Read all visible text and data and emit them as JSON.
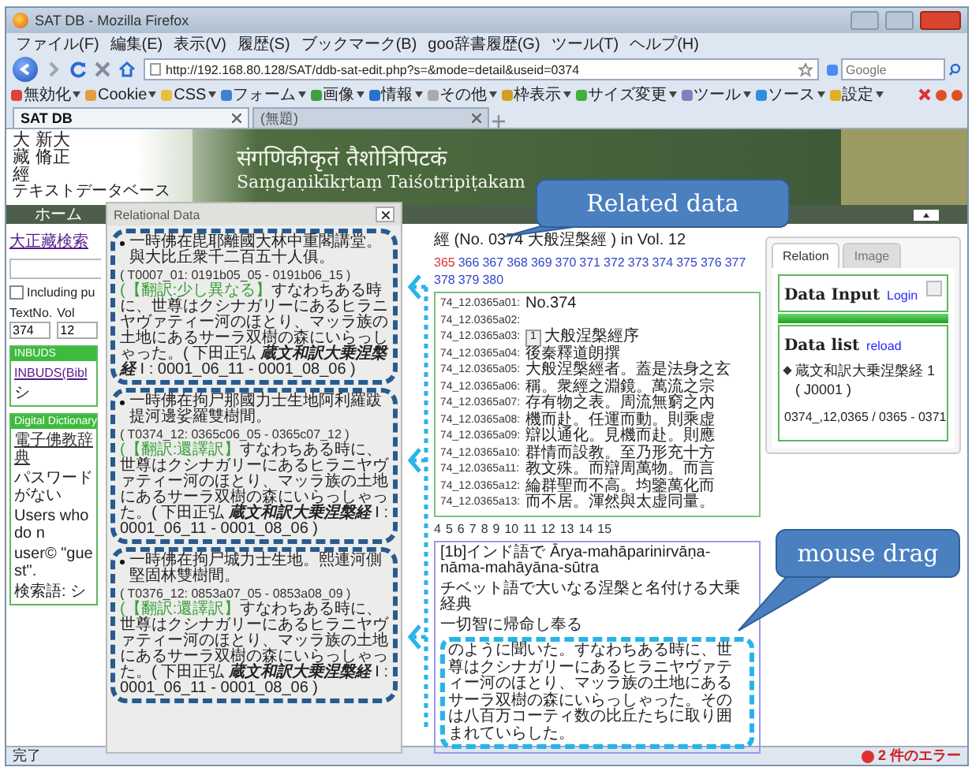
{
  "window": {
    "title": "SAT DB - Mozilla Firefox"
  },
  "menu": [
    "ファイル(F)",
    "編集(E)",
    "表示(V)",
    "履歴(S)",
    "ブックマーク(B)",
    "goo辞書履歴(G)",
    "ツール(T)",
    "ヘルプ(H)"
  ],
  "address_bar": {
    "value": "http://192.168.80.128/SAT/ddb-sat-edit.php?s=&mode=detail&useid=0374"
  },
  "search_bar": {
    "placeholder": "Google"
  },
  "toolbar": [
    "無効化",
    "Cookie",
    "CSS",
    "フォーム",
    "画像",
    "情報",
    "その他",
    "枠表示",
    "サイズ変更",
    "ツール",
    "ソース",
    "設定"
  ],
  "tabs": [
    {
      "label": "SAT DB",
      "selected": true
    },
    {
      "label": "(無題)",
      "selected": false
    }
  ],
  "header": {
    "logo_lines": [
      "大 新大",
      "藏 脩正",
      "經"
    ],
    "subtitle": "テキストデータベース",
    "title": "संगणिकीकृतं तैशोत्रिपिटकं",
    "title_latin": "Saṃgaṇikīkṛtaṃ Taiśotripiṭakam"
  },
  "nav": [
    "ホーム"
  ],
  "left": {
    "search_link": "大正藏検索",
    "checkbox": {
      "label": "Including pu",
      "checked": false
    },
    "fields": [
      {
        "label": "TextNo.",
        "value": "374"
      },
      {
        "label": "Vol",
        "value": "12"
      }
    ],
    "inbuds": {
      "title": "INBUDS",
      "link": "INBUDS(Bibl",
      "text": "シ"
    },
    "dictionary": {
      "title": "Digital Dictionary",
      "link": "電子佛教辞典",
      "lines": [
        "パスワードがない",
        "Users who do n",
        "user© \"guest\"."
      ],
      "search": "検索語: シ"
    }
  },
  "relational_panel": {
    "title": "Relational Data",
    "items": [
      {
        "source": "一時佛在毘耶離國大林中重閣講堂。與大比丘衆千二百五十人俱。",
        "ref": "( T0007_01: 0191b05_05 - 0191b06_15 )",
        "label": "(【翻訳:少し異なる】",
        "translation": "すなわちある時に、世尊はクシナガリーにあるヒラニヤヴァティー河のほとり、マッラ族の土地にあるサーラ双樹の森にいらっしゃった。( 下田正弘 **蔵文和訳大乗涅槃経** I : 0001_06_11 - 0001_08_06 )"
      },
      {
        "source": "一時佛在拘尸那國力士生地阿利羅跋提河邊娑羅雙樹間。",
        "ref": "( T0374_12: 0365c06_05 - 0365c07_12 )",
        "label": "(【翻訳:還譯訳】",
        "translation": "すなわちある時に、世尊はクシナガリーにあるヒラニヤヴァティー河のほとり、マッラ族の土地にあるサーラ双樹の森にいらっしゃった。( 下田正弘 **蔵文和訳大乗涅槃経** I : 0001_06_11 - 0001_08_06 )"
      },
      {
        "source": "一時佛在拘尸城力士生地。熙連河側堅固林雙樹間。",
        "ref": "( T0376_12: 0853a07_05 - 0853a08_09 )",
        "label": "(【翻訳:還譯訳】",
        "translation": "すなわちある時に、世尊はクシナガリーにあるヒラニヤヴァティー河のほとり、マッラ族の土地にあるサーラ双樹の森にいらっしゃった。( 下田正弘 **蔵文和訳大乗涅槃経** I : 0001_06_11 - 0001_08_06 )"
      }
    ]
  },
  "text_view": {
    "title": "經 (No. 0374 大般涅槃經 ) in Vol. 12",
    "pages": [
      {
        "label": "365",
        "selected": true
      },
      {
        "label": "366",
        "selected": false
      },
      {
        "label": "367",
        "selected": false
      },
      {
        "label": "368",
        "selected": false
      },
      {
        "label": "369",
        "selected": false
      },
      {
        "label": "370",
        "selected": false
      },
      {
        "label": "371",
        "selected": false
      },
      {
        "label": "372",
        "selected": false
      },
      {
        "label": "373",
        "selected": false
      },
      {
        "label": "374",
        "selected": false
      },
      {
        "label": "375",
        "selected": false
      },
      {
        "label": "376",
        "selected": false
      },
      {
        "label": "377",
        "selected": false
      },
      {
        "label": "378",
        "selected": false
      },
      {
        "label": "379",
        "selected": false
      },
      {
        "label": "380",
        "selected": false
      }
    ],
    "lines": [
      {
        "ref": "74_12.0365a01:",
        "text": "No.374"
      },
      {
        "ref": "74_12.0365a02:"
      },
      {
        "ref": "74_12.0365a03:",
        "marker": "1",
        "text": "大般涅槃經序"
      },
      {
        "ref": "74_12.0365a04:",
        "text": "後秦釋道朗撰"
      },
      {
        "ref": "74_12.0365a05:",
        "text": "大般涅槃經者。蓋是法身之玄"
      },
      {
        "ref": "74_12.0365a06:",
        "text": "稱。衆經之淵鏡。萬流之宗"
      },
      {
        "ref": "74_12.0365a07:",
        "text": "存有物之表。周流無窮之內"
      },
      {
        "ref": "74_12.0365a08:",
        "text": "機而赴。任運而動。則乘虚"
      },
      {
        "ref": "74_12.0365a09:",
        "text": "辯以通化。見機而赴。則應"
      },
      {
        "ref": "74_12.0365a10:",
        "text": "群情而設教。至乃形充十方"
      },
      {
        "ref": "74_12.0365a11:",
        "text": "教文殊。而辯周萬物。而言"
      },
      {
        "ref": "74_12.0365a12:",
        "text": "綸群聖而不高。均鑒萬化而"
      },
      {
        "ref": "74_12.0365a13:",
        "text": "而不居。渾然與太虚同量。"
      }
    ],
    "page_links": [
      "4",
      "5",
      "6",
      "7",
      "8",
      "9",
      "10",
      "11",
      "12",
      "13",
      "14",
      "15"
    ],
    "translation": [
      "[1b]インド語で Ārya-mahāparinirvāṇa-nāma-mahāyāna-sūtra",
      "チベット語で大いなる涅槃と名付ける大乗経典",
      "一切智に帰命し奉る",
      "のように聞いた。すなわちある時に、世尊はクシナガリーにあるヒラニヤヴァティー河のほとり、マッラ族の土地にあるサーラ双樹の森にいらっしゃった。そのは八百万コーティ数の比丘たちに取り囲まれていらした。"
    ]
  },
  "relation_box": {
    "tabs": [
      {
        "label": "Relation",
        "selected": true
      },
      {
        "label": "Image",
        "selected": false
      }
    ],
    "data_input": {
      "title": "Data Input",
      "link": "Login"
    },
    "data_list": {
      "title": "Data list",
      "link": "reload",
      "items": [
        "蔵文和訳大乗涅槃経 1 ( J0001 )"
      ],
      "range": "0374_,12,0365 / 0365 - 0371"
    }
  },
  "status_bar": {
    "text": "完了",
    "errors": "2 件のエラー"
  },
  "annotations": [
    {
      "kind": "callout",
      "text": "Related data"
    },
    {
      "kind": "callout",
      "text": "mouse drag"
    }
  ]
}
